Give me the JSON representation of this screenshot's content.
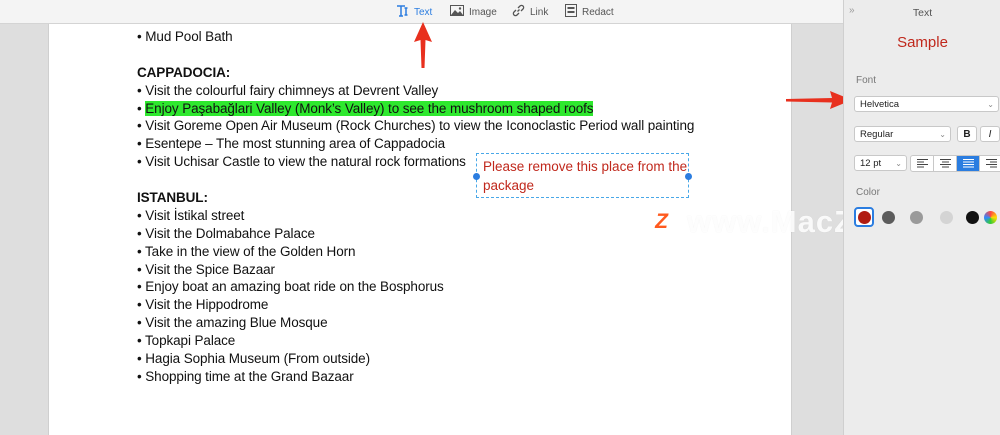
{
  "toolbar": {
    "text_label": "Text",
    "image_label": "Image",
    "link_label": "Link",
    "redact_label": "Redact"
  },
  "document": {
    "line_0": "• Mud Pool Bath",
    "heading_cappadocia": "CAPPADOCIA:",
    "line_1": "• Visit the colourful fairy chimneys at Devrent Valley",
    "line_2_bullet": "• ",
    "line_2_highlight": "Enjoy Paşabağlari Valley (Monk’s Valley) to see the mushroom shaped roofs",
    "line_3": "• Visit Goreme Open Air Museum (Rock Churches) to view the Iconoclastic Period wall painting",
    "line_4": "• Esentepe – The most stunning area of Cappadocia",
    "line_5": "• Visit Uchisar Castle to view the natural rock formations",
    "heading_istanbul": "ISTANBUL:",
    "line_6": "• Visit İstikal street",
    "line_7": "• Visit the Dolmabahce Palace",
    "line_8": "• Take in the view of the Golden Horn",
    "line_9": "• Visit the Spice Bazaar",
    "line_10": "• Enjoy boat an amazing boat ride on the Bosphorus",
    "line_11": "• Visit the Hippodrome",
    "line_12": "• Visit the amazing Blue Mosque",
    "line_13": "• Topkapi Palace",
    "line_14": "• Hagia Sophia Museum (From outside)",
    "line_15": "• Shopping time at the Grand Bazaar"
  },
  "annotation": {
    "text": "Please remove this place from the package",
    "color": "#c0281c"
  },
  "watermark": {
    "logo_letter": "Z",
    "text": "www.MacZ.com"
  },
  "panel": {
    "title": "Text",
    "sample": "Sample",
    "font_label": "Font",
    "font_value": "Helvetica",
    "style_value": "Regular",
    "bold_label": "B",
    "italic_label": "I",
    "size_value": "12 pt",
    "color_label": "Color",
    "alignment_selected": "justify"
  },
  "colors": {
    "accent": "#2b7de0",
    "highlight": "#2ee82e",
    "arrow": "#e8301e"
  },
  "icons": {
    "text_tool": "text-cursor-icon",
    "image_tool": "image-icon",
    "link_tool": "link-icon",
    "redact_tool": "redact-icon"
  }
}
